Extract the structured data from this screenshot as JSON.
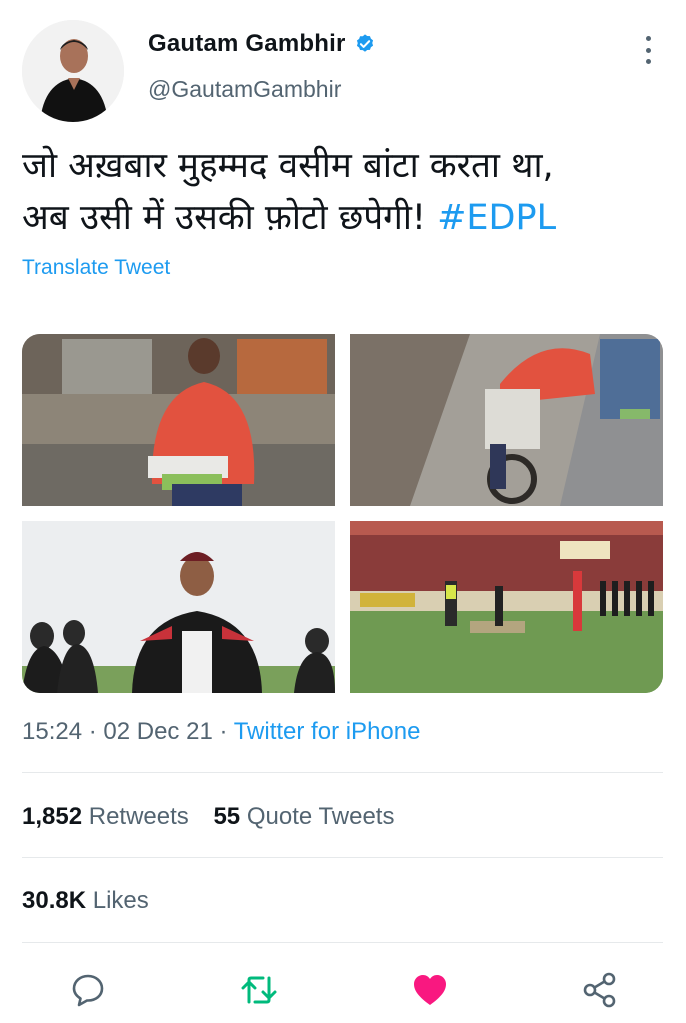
{
  "author": {
    "name": "Gautam Gambhir",
    "handle": "@GautamGambhir",
    "verified": true
  },
  "tweet": {
    "line1": "जो अख़बार मुहम्मद वसीम बांटा करता था,",
    "line2": "अब उसी में उसकी फ़ोटो छपेगी! ",
    "hashtag": "#EDPL",
    "translate_label": "Translate Tweet"
  },
  "meta": {
    "time": "15:24",
    "sep1": " · ",
    "date": "02 Dec 21",
    "sep2": " · ",
    "source": "Twitter for iPhone"
  },
  "stats": {
    "retweets_count": "1,852",
    "retweets_label": "Retweets",
    "quotes_count": "55",
    "quotes_label": "Quote Tweets",
    "likes_count": "30.8K",
    "likes_label": "Likes"
  },
  "colors": {
    "accent": "#1d9bf0",
    "retweet": "#00ba7c",
    "like": "#f91880",
    "muted": "#536471"
  },
  "icons": {
    "reply": "speech-bubble-icon",
    "retweet": "retweet-arrows-icon",
    "like": "heart-filled-icon",
    "share": "share-nodes-icon"
  }
}
